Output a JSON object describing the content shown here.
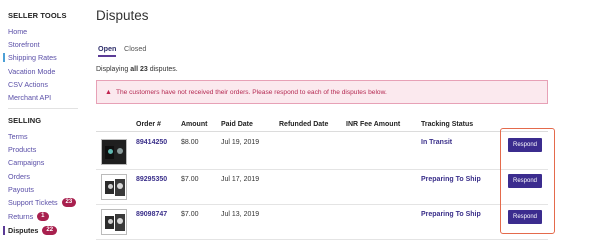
{
  "sidebar": {
    "seller_tools_heading": "SELLER TOOLS",
    "seller_tools": [
      {
        "label": "Home"
      },
      {
        "label": "Storefront"
      },
      {
        "label": "Shipping Rates"
      },
      {
        "label": "Vacation Mode"
      },
      {
        "label": "CSV Actions"
      },
      {
        "label": "Merchant API"
      }
    ],
    "selling_heading": "SELLING",
    "selling": [
      {
        "label": "Terms"
      },
      {
        "label": "Products"
      },
      {
        "label": "Campaigns"
      },
      {
        "label": "Orders"
      },
      {
        "label": "Payouts"
      },
      {
        "label": "Support Tickets",
        "badge": "23"
      },
      {
        "label": "Returns",
        "badge": "1"
      },
      {
        "label": "Disputes",
        "badge": "22"
      }
    ]
  },
  "page": {
    "title": "Disputes",
    "tabs": [
      {
        "label": "Open",
        "active": true
      },
      {
        "label": "Closed",
        "active": false
      }
    ],
    "displaying_prefix": "Displaying ",
    "displaying_count": "all 23",
    "displaying_suffix": " disputes.",
    "alert_icon": "warning-icon",
    "alert_text": "The customers have not received their orders. Please respond to each of the disputes below."
  },
  "table": {
    "headers": [
      "Order #",
      "Amount",
      "Paid Date",
      "Refunded Date",
      "INR Fee Amount",
      "Tracking Status"
    ],
    "respond_label": "Respond",
    "rows": [
      {
        "order": "89414250",
        "amount": "$8.00",
        "paid_date": "Jul 19, 2019",
        "refunded_date": "",
        "inr_fee": "",
        "tracking_status": "In Transit"
      },
      {
        "order": "89295350",
        "amount": "$7.00",
        "paid_date": "Jul 17, 2019",
        "refunded_date": "",
        "inr_fee": "",
        "tracking_status": "Preparing To Ship"
      },
      {
        "order": "89098747",
        "amount": "$7.00",
        "paid_date": "Jul 13, 2019",
        "refunded_date": "",
        "inr_fee": "",
        "tracking_status": "Preparing To Ship"
      }
    ]
  },
  "colors": {
    "accent": "#3b2c8e",
    "alert_bg": "#fbe9ee",
    "alert_text": "#b42a52",
    "badge": "#a8204e",
    "highlight_outline": "#e46a4c"
  }
}
